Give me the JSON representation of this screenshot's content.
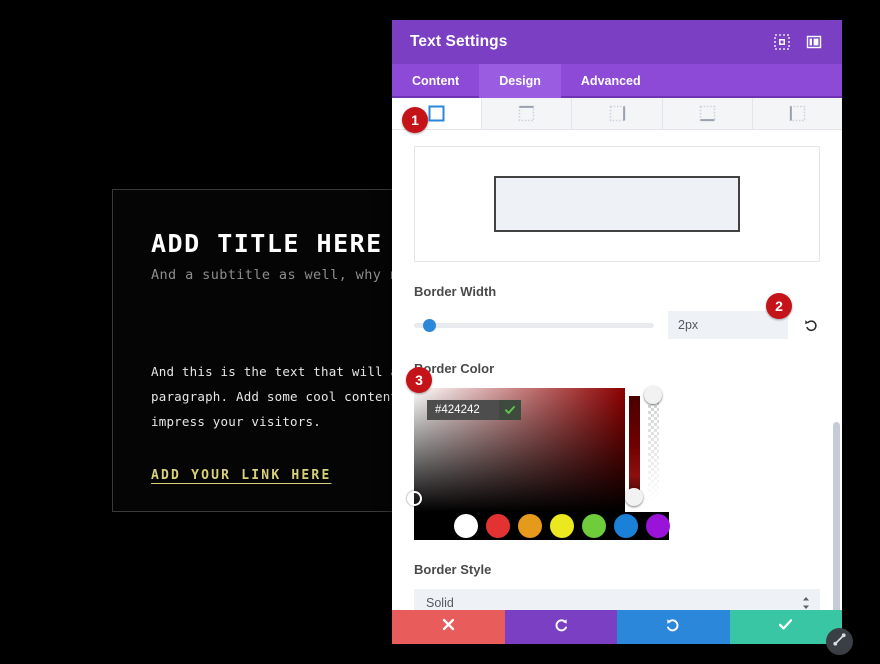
{
  "site_preview": {
    "title": "ADD TITLE HERE",
    "subtitle": "And a subtitle as well, why not",
    "paragraph": "And this is the text that will appear as a paragraph. Add some cool content here to impress your visitors.",
    "link_text": "ADD YOUR LINK HERE",
    "link_color": "#d8d17a",
    "background": "#000000"
  },
  "modal": {
    "title": "Text Settings",
    "accent_color": "#7b3fc4",
    "header_icons": [
      {
        "name": "expand-icon"
      },
      {
        "name": "layout-panel-icon"
      }
    ],
    "tabs": [
      {
        "label": "Content",
        "active": false
      },
      {
        "label": "Design",
        "active": true
      },
      {
        "label": "Advanced",
        "active": false
      }
    ],
    "side_tabs": [
      {
        "name": "border-all-sides",
        "active": true
      },
      {
        "name": "border-top-side",
        "active": false
      },
      {
        "name": "border-right-side",
        "active": false
      },
      {
        "name": "border-bottom-side",
        "active": false
      },
      {
        "name": "border-left-side",
        "active": false
      }
    ],
    "preview": {
      "border_color": "#424242",
      "border_width": "2px",
      "fill_color": "#eef1f6"
    },
    "border_width": {
      "label": "Border Width",
      "value": "2px",
      "slider_percent": 4,
      "reset_icon": "reset-arrow-icon"
    },
    "border_color": {
      "label": "Border Color",
      "hex_value": "#424242",
      "confirm_icon": "checkmark-icon",
      "swatches": [
        {
          "name": "swatch-black",
          "color": "#000000"
        },
        {
          "name": "swatch-white",
          "color": "#ffffff"
        },
        {
          "name": "swatch-red",
          "color": "#e33232"
        },
        {
          "name": "swatch-orange",
          "color": "#e59a1c"
        },
        {
          "name": "swatch-yellow",
          "color": "#ece81f"
        },
        {
          "name": "swatch-green",
          "color": "#6fcc3a"
        },
        {
          "name": "swatch-blue",
          "color": "#1b81d8"
        },
        {
          "name": "swatch-purple",
          "color": "#9a13d8"
        }
      ]
    },
    "border_style": {
      "label": "Border Style",
      "selected": "Solid"
    },
    "footer": {
      "cancel": {
        "name": "cancel-button",
        "color": "#e85c5c",
        "icon": "close-x-icon"
      },
      "undo": {
        "name": "undo-button",
        "color": "#7b3fc4",
        "icon": "undo-arrow-icon"
      },
      "redo": {
        "name": "redo-button",
        "color": "#2b87da",
        "icon": "redo-arrow-icon"
      },
      "save": {
        "name": "save-button",
        "color": "#38c6a4",
        "icon": "checkmark-icon"
      }
    },
    "resize_handle": {
      "name": "resize-handle",
      "icon": "diagonal-resize-icon"
    }
  },
  "callouts": [
    {
      "number": "1"
    },
    {
      "number": "2"
    },
    {
      "number": "3"
    }
  ]
}
